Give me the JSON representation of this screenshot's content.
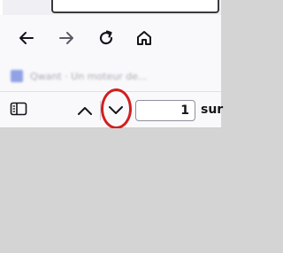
{
  "browser": {
    "bookmarks_bar": {
      "items": [
        {
          "label": "Qwant · Un moteur de...",
          "icon": "bookmark-favicon"
        }
      ]
    },
    "nav": {
      "back_icon": "back-arrow-icon",
      "forward_icon": "forward-arrow-icon",
      "reload_icon": "reload-icon",
      "home_icon": "home-icon"
    }
  },
  "pdf_viewer": {
    "sidebar_toggle_icon": "sidebar-toggle-icon",
    "prev_page_icon": "chevron-up-icon",
    "next_page_icon": "chevron-down-icon",
    "page_number": "1",
    "page_of_label": "sur",
    "highlight_color": "#d21e1e"
  }
}
